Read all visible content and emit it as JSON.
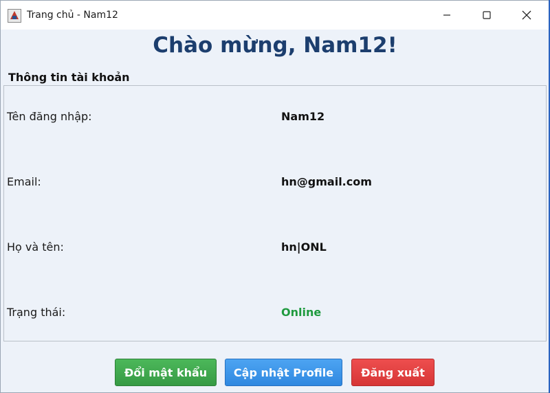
{
  "window": {
    "title": "Trang chủ - Nam12",
    "icon": "java-app-icon"
  },
  "main": {
    "heading": "Chào mừng, Nam12!",
    "section_title": "Thông tin tài khoản"
  },
  "account": {
    "rows": [
      {
        "label": "Tên đăng nhập:",
        "value": "Nam12"
      },
      {
        "label": "Email:",
        "value": "hn@gmail.com"
      },
      {
        "label": "Họ và tên:",
        "value": "hn|ONL"
      },
      {
        "label": "Trạng thái:",
        "value": "Online"
      }
    ]
  },
  "buttons": {
    "change_password": "Đổi mật khẩu",
    "update_profile": "Cập nhật Profile",
    "logout": "Đăng xuất"
  },
  "colors": {
    "heading": "#1c3e6e",
    "status_online": "#1f9a3f",
    "button_green": "#3fa94c",
    "button_blue": "#3a93e8",
    "button_red": "#e24040"
  }
}
